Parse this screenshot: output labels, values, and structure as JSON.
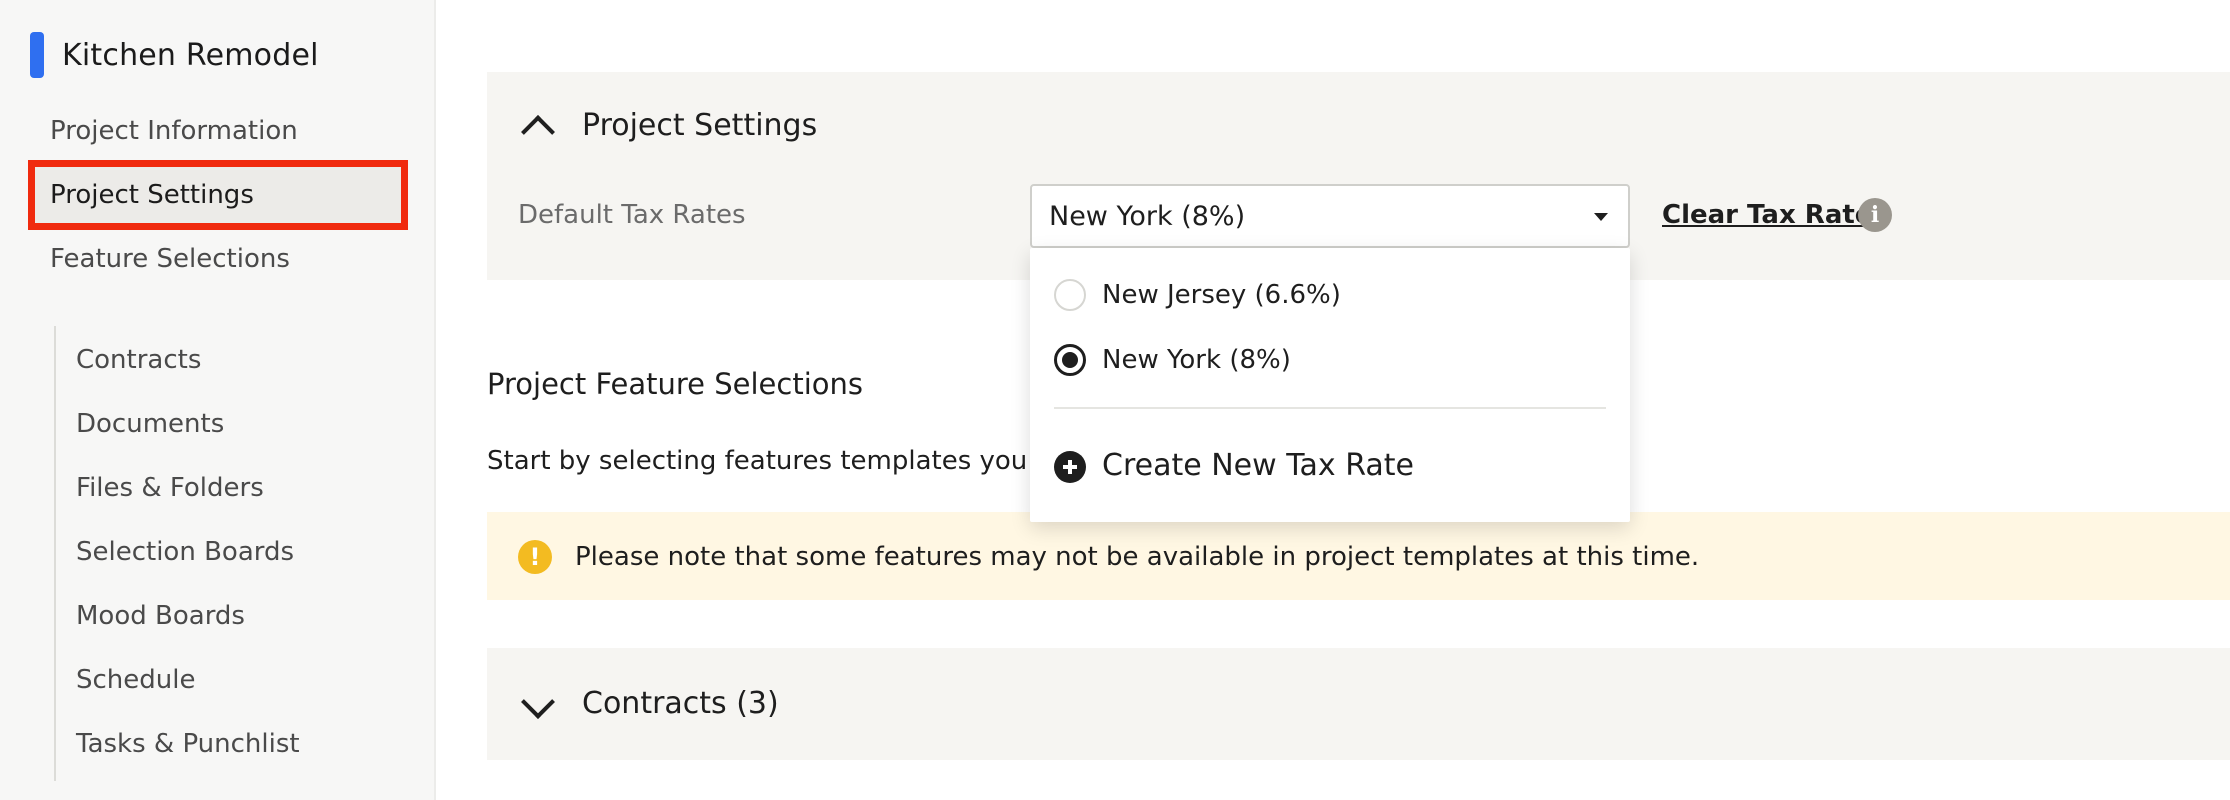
{
  "sidebar": {
    "title": "Kitchen Remodel",
    "accent_color": "#2f6ff0",
    "items": [
      {
        "label": "Project Information"
      },
      {
        "label": "Project Settings"
      },
      {
        "label": "Feature Selections"
      }
    ],
    "sub_items": [
      {
        "label": "Contracts"
      },
      {
        "label": "Documents"
      },
      {
        "label": "Files & Folders"
      },
      {
        "label": "Selection Boards"
      },
      {
        "label": "Mood Boards"
      },
      {
        "label": "Schedule"
      },
      {
        "label": "Tasks & Punchlist"
      }
    ],
    "highlight_color": "#f02a0e"
  },
  "project_settings": {
    "title": "Project Settings",
    "tax_label": "Default Tax Rates",
    "selected_tax": "New York (8%)",
    "clear_label": "Clear Tax Rate",
    "info_icon": "i"
  },
  "dropdown": {
    "options": [
      {
        "label": "New Jersey (6.6%)",
        "checked": false
      },
      {
        "label": "New York (8%)",
        "checked": true
      }
    ],
    "create_label": "Create New Tax Rate"
  },
  "feature_section": {
    "heading": "Project Feature Selections",
    "subtext": "Start by selecting features templates you w",
    "notice_icon": "!",
    "notice": "Please note that some features may not be available in project templates at this time.",
    "notice_color": "#f3bb21"
  },
  "contracts_panel": {
    "title": "Contracts (3)"
  }
}
